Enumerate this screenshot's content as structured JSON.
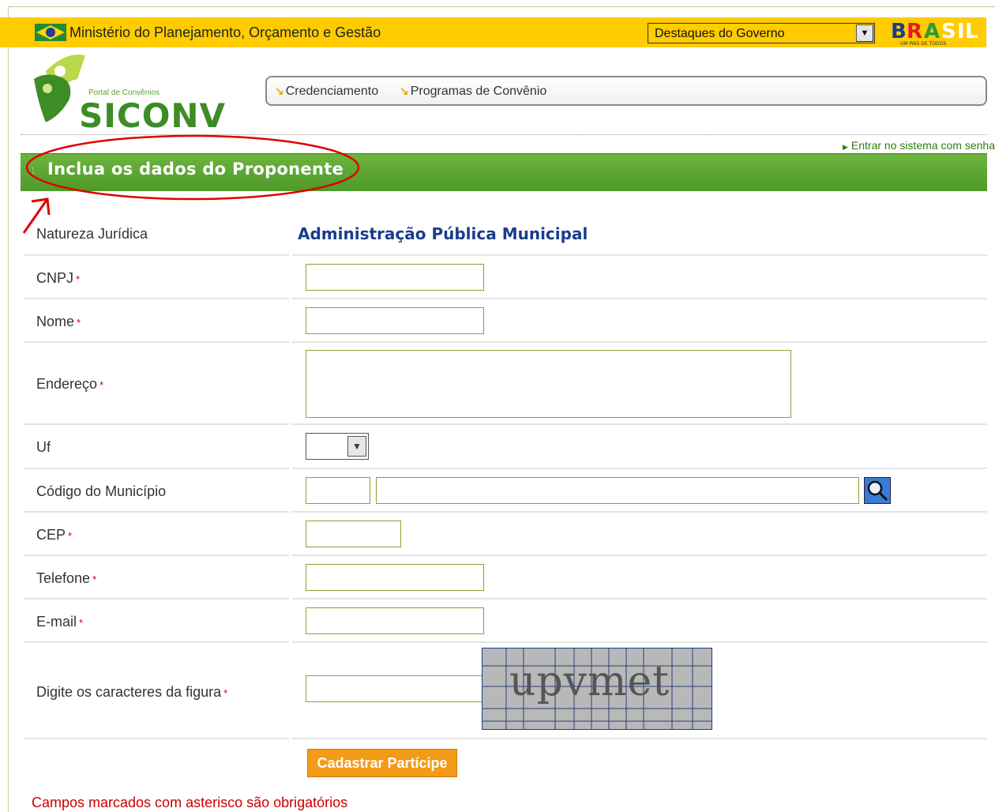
{
  "govbar": {
    "ministry": "Ministério do Planejamento, Orçamento e Gestão",
    "select_value": "Destaques do Governo",
    "brand": "BRASIL",
    "brand_tagline": "UM PAÍS DE TODOS"
  },
  "logo": {
    "portal": "Portal de Convênios",
    "name": "SICONV"
  },
  "menu": {
    "items": [
      "Credenciamento",
      "Programas de Convênio"
    ]
  },
  "login_link": "Entrar no sistema com senha",
  "section": {
    "title": "Inclua os dados do Proponente"
  },
  "form": {
    "natureza_label": "Natureza Jurídica",
    "natureza_value": "Administração Pública Municipal",
    "cnpj_label": "CNPJ",
    "nome_label": "Nome",
    "endereco_label": "Endereço",
    "uf_label": "Uf",
    "municipio_label": "Código do Município",
    "cep_label": "CEP",
    "telefone_label": "Telefone",
    "email_label": "E-mail",
    "captcha_label": "Digite os caracteres da figura",
    "captcha_text": "upvmet",
    "required_mark": "*"
  },
  "submit_label": "Cadastrar Partícipe",
  "footnote": "Campos marcados com asterisco são obrigatórios",
  "colors": {
    "gov_bar": "#ffcc00",
    "section_green": "#5aa633",
    "value_blue": "#1a3c8c",
    "button_orange": "#f39a17",
    "required_red": "#cc0000"
  }
}
